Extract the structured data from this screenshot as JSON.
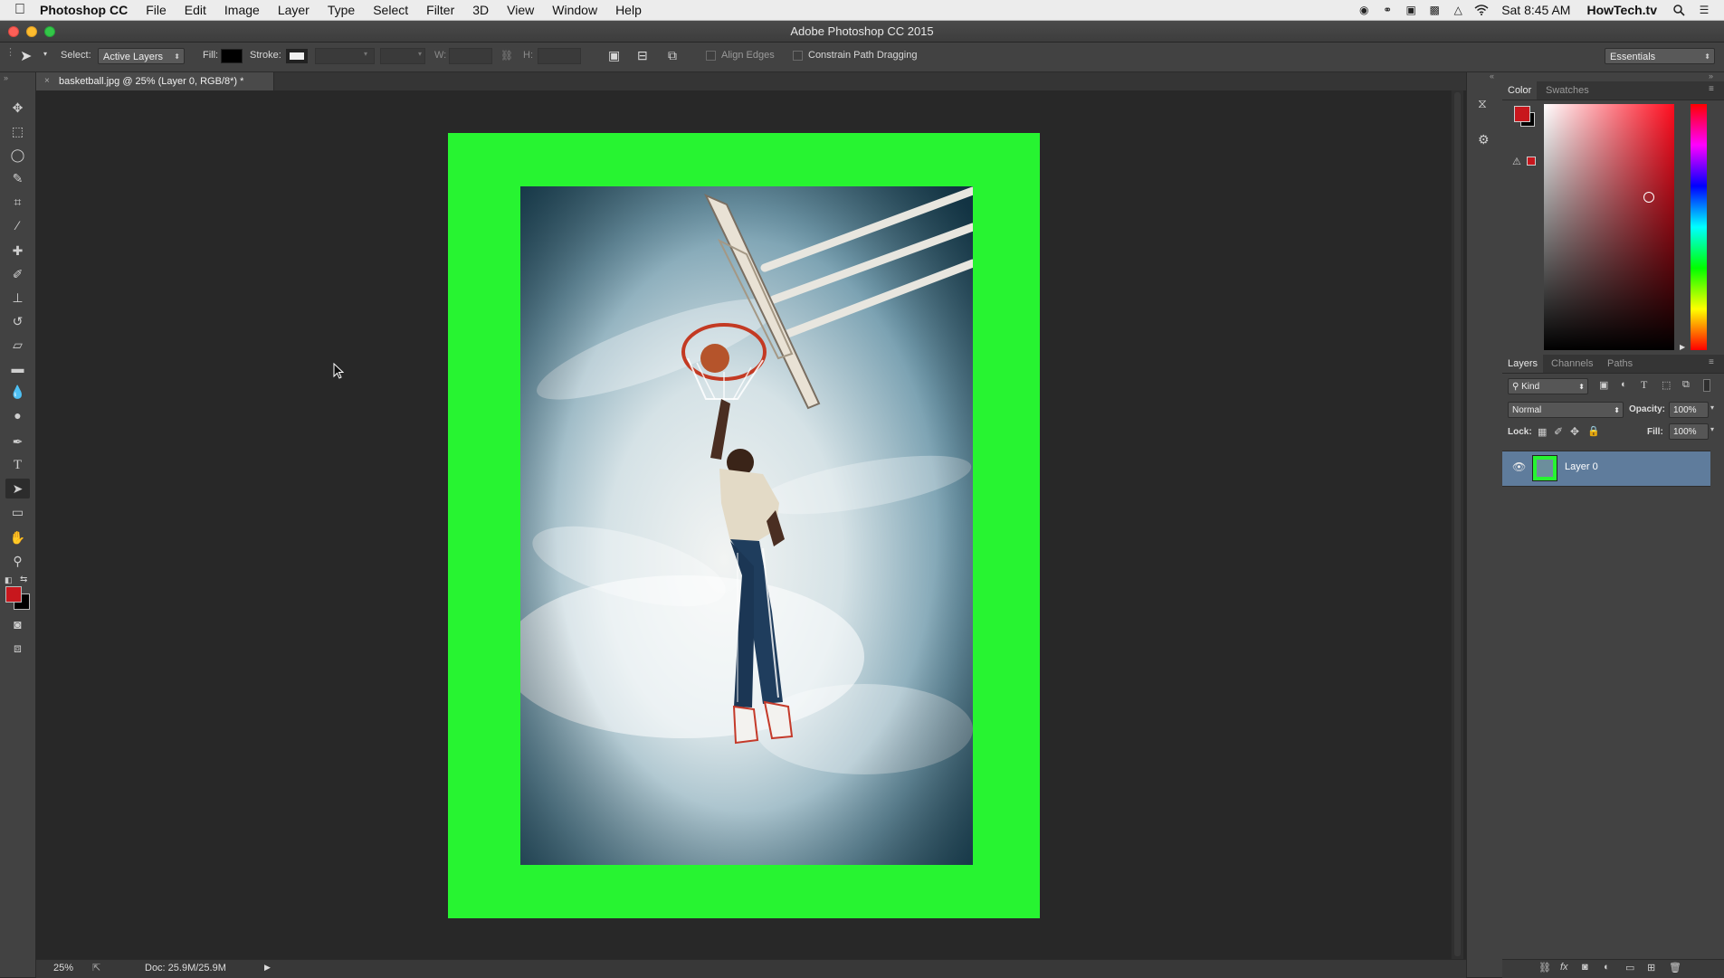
{
  "menubar": {
    "app_name": "Photoshop CC",
    "items": [
      "File",
      "Edit",
      "Image",
      "Layer",
      "Type",
      "Select",
      "Filter",
      "3D",
      "View",
      "Window",
      "Help"
    ],
    "clock": "Sat 8:45 AM",
    "user": "HowTech.tv"
  },
  "window": {
    "title": "Adobe Photoshop CC 2015"
  },
  "options": {
    "select_label": "Select:",
    "select_value": "Active Layers",
    "fill_label": "Fill:",
    "stroke_label": "Stroke:",
    "w_label": "W:",
    "h_label": "H:",
    "align_edges": "Align Edges",
    "constrain": "Constrain Path Dragging",
    "workspace": "Essentials"
  },
  "document": {
    "tab_title": "basketball.jpg @ 25% (Layer 0, RGB/8*) *",
    "zoom": "25%",
    "doc_size": "Doc: 25.9M/25.9M"
  },
  "color_panel": {
    "tabs": [
      "Color",
      "Swatches"
    ],
    "foreground": "#c8171d",
    "background": "#000000"
  },
  "layers_panel": {
    "tabs": [
      "Layers",
      "Channels",
      "Paths"
    ],
    "kind_filter": "Kind",
    "blend_mode": "Normal",
    "opacity_label": "Opacity:",
    "opacity": "100%",
    "lock_label": "Lock:",
    "fill_label": "Fill:",
    "fill": "100%",
    "layers": [
      {
        "name": "Layer 0",
        "visible": true
      }
    ]
  },
  "colors": {
    "frame_green": "#27f431",
    "accent_red": "#c8171d",
    "selected_layer": "#5f7c9c"
  }
}
